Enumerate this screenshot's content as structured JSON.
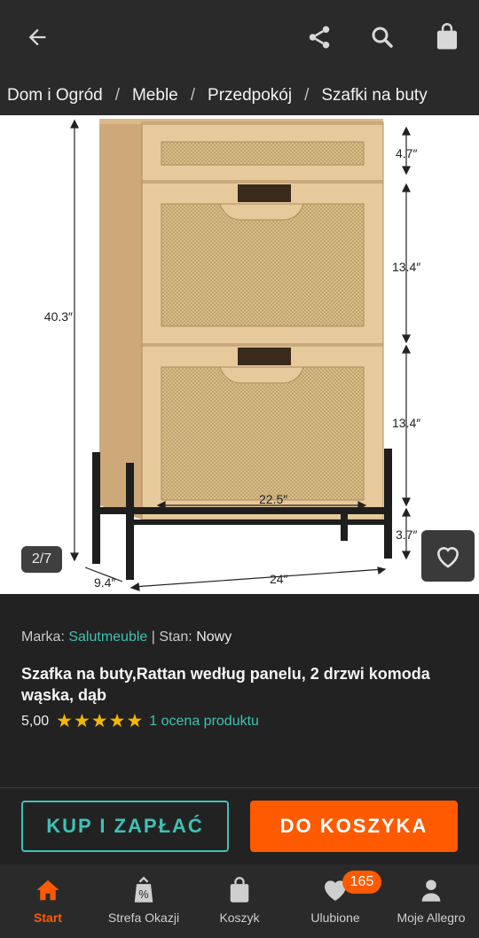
{
  "topbar": {
    "back_icon": "arrow-left-icon",
    "share_icon": "share-icon",
    "search_icon": "search-icon",
    "bag_icon": "shopping-bag-icon"
  },
  "breadcrumb": [
    "Dom i Ogród",
    "Meble",
    "Przedpokój",
    "Szafki na buty"
  ],
  "gallery": {
    "pager": "2/7",
    "dimensions": {
      "height_total": "40.3″",
      "drawer_top": "4.7″",
      "door_1": "13.4″",
      "door_2": "13.4″",
      "legs": "3.7″",
      "inner_width": "22.5″",
      "depth": "9.4″",
      "width": "24″"
    }
  },
  "product": {
    "brand_label": "Marka:",
    "brand": "Salutmeuble",
    "divider": "|",
    "condition_label": "Stan:",
    "condition": "Nowy",
    "title": "Szafka na buty,Rattan według panelu, 2 drzwi komoda wąska, dąb",
    "rating_value": "5,00",
    "stars": 5,
    "rating_count": "1 ocena produktu"
  },
  "actions": {
    "buy_label": "KUP I ZAPŁAĆ",
    "cart_label": "DO KOSZYKA"
  },
  "nav": [
    {
      "label": "Start",
      "icon": "home-icon",
      "active": true
    },
    {
      "label": "Strefa Okazji",
      "icon": "discount-bag-icon",
      "active": false
    },
    {
      "label": "Koszyk",
      "icon": "cart-bag-icon",
      "active": false
    },
    {
      "label": "Ulubione",
      "icon": "heart-icon",
      "active": false,
      "badge": "165"
    },
    {
      "label": "Moje Allegro",
      "icon": "user-icon",
      "active": false
    }
  ],
  "colors": {
    "accent_orange": "#ff5a00",
    "accent_teal": "#3fc1b6",
    "background": "#222222",
    "star": "#f5b800"
  }
}
